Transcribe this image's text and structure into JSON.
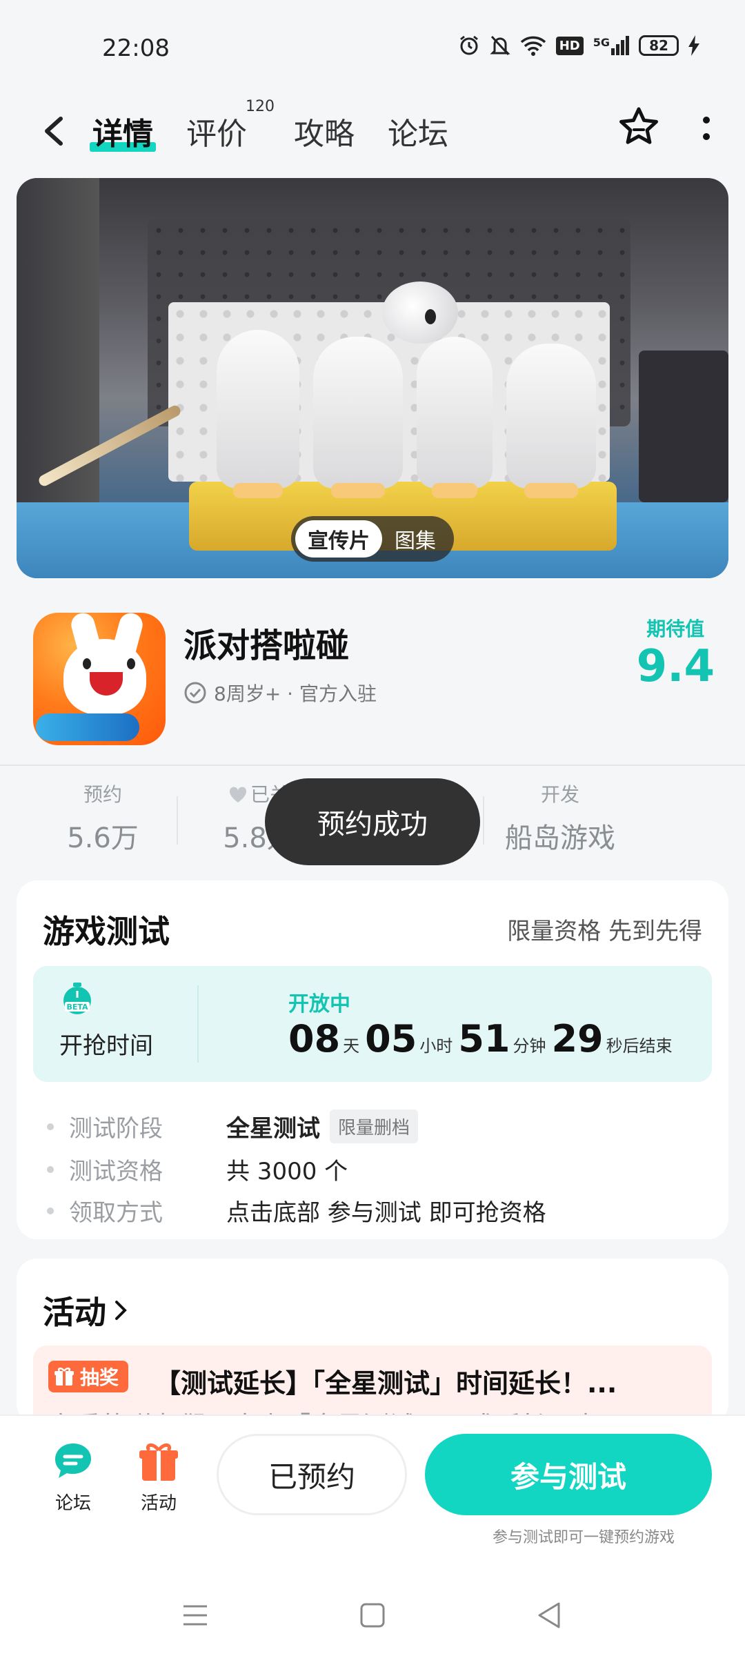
{
  "status_bar": {
    "time": "22:08",
    "hd": "HD",
    "network": "5G",
    "battery": "82"
  },
  "nav": {
    "tabs": [
      {
        "label": "详情",
        "active": true
      },
      {
        "label": "评价",
        "badge": "120"
      },
      {
        "label": "攻略"
      },
      {
        "label": "论坛"
      }
    ]
  },
  "banner": {
    "switch_options": [
      "宣传片",
      "图集"
    ]
  },
  "game": {
    "title": "派对搭啦碰",
    "meta": "8周岁+ · 官方入驻",
    "expect_label": "期待值",
    "expect_value": "9.4"
  },
  "stats": [
    {
      "label": "预约",
      "value": "5.6万"
    },
    {
      "label": "已关",
      "value": "5.8万"
    },
    {
      "label": "开发",
      "value": "船岛游戏"
    }
  ],
  "toast": "预约成功",
  "test_card": {
    "title": "游戏测试",
    "subtitle": "限量资格 先到先得",
    "timer_label": "开抢时间",
    "timer_status": "开放中",
    "countdown": {
      "days": "08",
      "days_unit": "天",
      "hours": "05",
      "hours_unit": "小时",
      "minutes": "51",
      "minutes_unit": "分钟",
      "seconds": "29",
      "seconds_unit": "秒后结束"
    },
    "details": [
      {
        "key": "测试阶段",
        "value": "全星测试",
        "tag": "限量删档"
      },
      {
        "key": "测试资格",
        "value": "共 3000 个"
      },
      {
        "key": "领取方式",
        "value": "点击底部 参与测试 即可抢资格"
      }
    ]
  },
  "activity": {
    "title": "活动",
    "tag": "抽奖",
    "headline": "【测试延长】「全星测试」时间延长！...",
    "subline": "亲爱的磁友们，本次「全星测试」正式延长，本..."
  },
  "bottom_bar": {
    "forum_label": "论坛",
    "activity_label": "活动",
    "reserved_label": "已预约",
    "join_label": "参与测试",
    "join_hint": "参与测试即可一键预约游戏"
  },
  "colors": {
    "accent": "#13d6c2",
    "accent_text": "#13c4b2",
    "orange": "#ff6a3d"
  }
}
